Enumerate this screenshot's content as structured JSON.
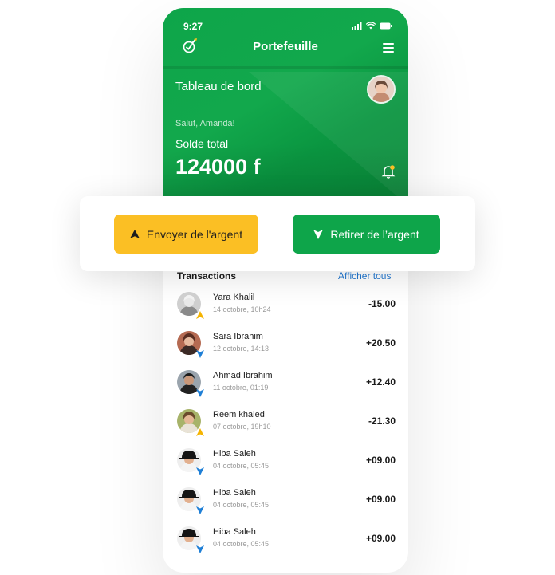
{
  "status": {
    "time": "9:27"
  },
  "header": {
    "title": "Portefeuille",
    "dashboard": "Tableau de bord",
    "greeting": "Salut, Amanda!",
    "balance_label": "Solde total",
    "balance": "124000 f"
  },
  "actions": {
    "send_label": "Envoyer de l'argent",
    "withdraw_label": "Retirer de l’argent"
  },
  "transactions": {
    "title": "Transactions",
    "view_all": "Afficher tous",
    "items": [
      {
        "name": "Yara Khalil",
        "date": "14 octobre, 10h24",
        "amount": "-15.00",
        "direction": "sent"
      },
      {
        "name": "Sara Ibrahim",
        "date": "12 octobre, 14:13",
        "amount": "+20.50",
        "direction": "received"
      },
      {
        "name": "Ahmad Ibrahim",
        "date": "11 octobre, 01:19",
        "amount": "+12.40",
        "direction": "received"
      },
      {
        "name": "Reem khaled",
        "date": "07 octobre, 19h10",
        "amount": "-21.30",
        "direction": "sent"
      },
      {
        "name": "Hiba Saleh",
        "date": "04 octobre, 05:45",
        "amount": "+09.00",
        "direction": "received"
      },
      {
        "name": "Hiba Saleh",
        "date": "04 octobre, 05:45",
        "amount": "+09.00",
        "direction": "received"
      },
      {
        "name": "Hiba Saleh",
        "date": "04 octobre, 05:45",
        "amount": "+09.00",
        "direction": "received"
      }
    ]
  },
  "colors": {
    "brand_green": "#0ea54a",
    "send_yellow": "#fbbf24",
    "link_blue": "#1f6fc2",
    "received_arrow": "#1f7fd6",
    "sent_arrow": "#f5b400"
  },
  "icons": [
    "logo-icon",
    "signal-icon",
    "wifi-icon",
    "battery-icon",
    "menu-icon",
    "bell-icon",
    "send-arrow-icon",
    "withdraw-arrow-icon"
  ]
}
